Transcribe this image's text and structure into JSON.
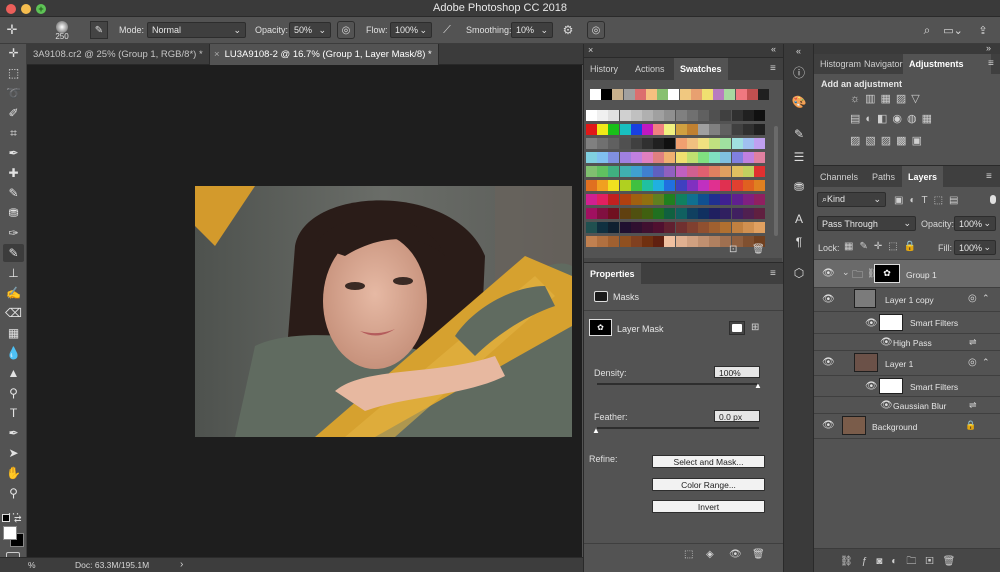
{
  "app": {
    "title": "Adobe Photoshop CC 2018"
  },
  "options": {
    "brush_size": "250",
    "mode_label": "Mode:",
    "mode_value": "Normal",
    "opacity_label": "Opacity:",
    "opacity_value": "50%",
    "flow_label": "Flow:",
    "flow_value": "100%",
    "smoothing_label": "Smoothing:",
    "smoothing_value": "10%"
  },
  "documents": {
    "tab1": "3A9108.cr2 @ 25% (Group 1, RGB/8*) *",
    "tab2_close": "×",
    "tab2": "LU3A9108-2 @ 16.7% (Group 1, Layer Mask/8) *"
  },
  "status": {
    "zoom": "%",
    "doc": "Doc: 63.3M/195.1M",
    "arrow": "›"
  },
  "top_panel": {
    "tabs": [
      "History",
      "Actions",
      "Swatches"
    ],
    "active_tab": "Swatches",
    "swatch_top": [
      "#ffffff",
      "#000000",
      "#c8b08c",
      "#a0a0a0",
      "#dc6e6e",
      "#f5c080",
      "#88c070",
      "#ffffff",
      "#f0c880",
      "#e8a070",
      "#f0e070",
      "#b87cc0",
      "#a8d8a0",
      "#f07880",
      "#c05050",
      "#202020"
    ],
    "swatch_rows": [
      [
        "#ffffff",
        "#f0f0f0",
        "#e0e0e0",
        "#d0d0d0",
        "#c0c0c0",
        "#b0b0b0",
        "#a0a0a0",
        "#909090",
        "#808080",
        "#707070",
        "#606060",
        "#505050",
        "#404040",
        "#303030",
        "#202020",
        "#101010"
      ],
      [
        "#e01818",
        "#f0e818",
        "#18c018",
        "#18c0c0",
        "#1840e0",
        "#c018c0",
        "#f08080",
        "#f0f080",
        "#d0a040",
        "#c08030",
        "#a0a0a0",
        "#808080",
        "#606060",
        "#404040",
        "#303030",
        "#202020"
      ],
      [
        "#808080",
        "#707070",
        "#606060",
        "#505050",
        "#404040",
        "#303030",
        "#202020",
        "#101010",
        "#f0a070",
        "#f0c080",
        "#f0e080",
        "#c0e080",
        "#a0e0a0",
        "#a0e0e0",
        "#a0c0f0",
        "#c0a0f0"
      ],
      [
        "#80d0e0",
        "#80c0f0",
        "#8090e0",
        "#a080e0",
        "#c080e0",
        "#e080c0",
        "#e08080",
        "#f0b070",
        "#f0e070",
        "#c0e070",
        "#80e080",
        "#80e0c0",
        "#80c0e0",
        "#8080e0",
        "#c080e0",
        "#e080a0"
      ],
      [
        "#80c070",
        "#60c060",
        "#40b080",
        "#40b0b0",
        "#40a0d0",
        "#4080d0",
        "#6060c0",
        "#9060c0",
        "#c060c0",
        "#d06090",
        "#e06070",
        "#e08060",
        "#e0a060",
        "#e0c060",
        "#c0d060",
        "#e03030"
      ],
      [
        "#e07020",
        "#f0a020",
        "#f0e020",
        "#b0d020",
        "#40c040",
        "#20c0a0",
        "#20b0e0",
        "#2070e0",
        "#4040c0",
        "#8030c0",
        "#c030c0",
        "#e03090",
        "#e03050",
        "#e04030",
        "#e06020",
        "#e08020"
      ],
      [
        "#d02090",
        "#e02060",
        "#c02020",
        "#b04010",
        "#a06010",
        "#907010",
        "#608020",
        "#208020",
        "#108060",
        "#107090",
        "#105090",
        "#203090",
        "#402090",
        "#602090",
        "#802080",
        "#902060"
      ],
      [
        "#a01060",
        "#801040",
        "#701020",
        "#604010",
        "#505010",
        "#406010",
        "#207020",
        "#106040",
        "#106060",
        "#104060",
        "#103060",
        "#202060",
        "#302060",
        "#402060",
        "#502050",
        "#602040"
      ],
      [
        "#205050",
        "#103040",
        "#102030",
        "#201030",
        "#301030",
        "#401030",
        "#501030",
        "#602030",
        "#703030",
        "#804030",
        "#905030",
        "#a06030",
        "#b07030",
        "#c08040",
        "#d09050",
        "#e0a060"
      ],
      [
        "#c08050",
        "#b07040",
        "#a06030",
        "#905020",
        "#804020",
        "#703010",
        "#602010",
        "#f0c0a0",
        "#e0b090",
        "#d0a080",
        "#c09070",
        "#b08060",
        "#a07050",
        "#906040",
        "#805030",
        "#704020"
      ]
    ]
  },
  "properties": {
    "tab": "Properties",
    "section": "Masks",
    "mask_label": "Layer Mask",
    "density_label": "Density:",
    "density_value": "100%",
    "feather_label": "Feather:",
    "feather_value": "0.0 px",
    "refine_label": "Refine:",
    "btn_select": "Select and Mask...",
    "btn_color": "Color Range...",
    "btn_invert": "Invert"
  },
  "adjustments": {
    "tabs": [
      "Histogram",
      "Navigator",
      "Adjustments"
    ],
    "active_tab": "Adjustments",
    "add_label": "Add an adjustment"
  },
  "layers_panel": {
    "tabs": [
      "Channels",
      "Paths",
      "Layers"
    ],
    "active_tab": "Layers",
    "filter_kind": "Kind",
    "blend_mode": "Pass Through",
    "opacity_label": "Opacity:",
    "opacity_value": "100%",
    "lock_label": "Lock:",
    "fill_label": "Fill:",
    "fill_value": "100%",
    "layers": [
      {
        "name": "Group 1"
      },
      {
        "name": "Layer 1 copy"
      },
      {
        "name": "Smart Filters"
      },
      {
        "name": "High Pass"
      },
      {
        "name": "Layer 1"
      },
      {
        "name": "Smart Filters"
      },
      {
        "name": "Gaussian Blur"
      },
      {
        "name": "Background"
      }
    ]
  }
}
